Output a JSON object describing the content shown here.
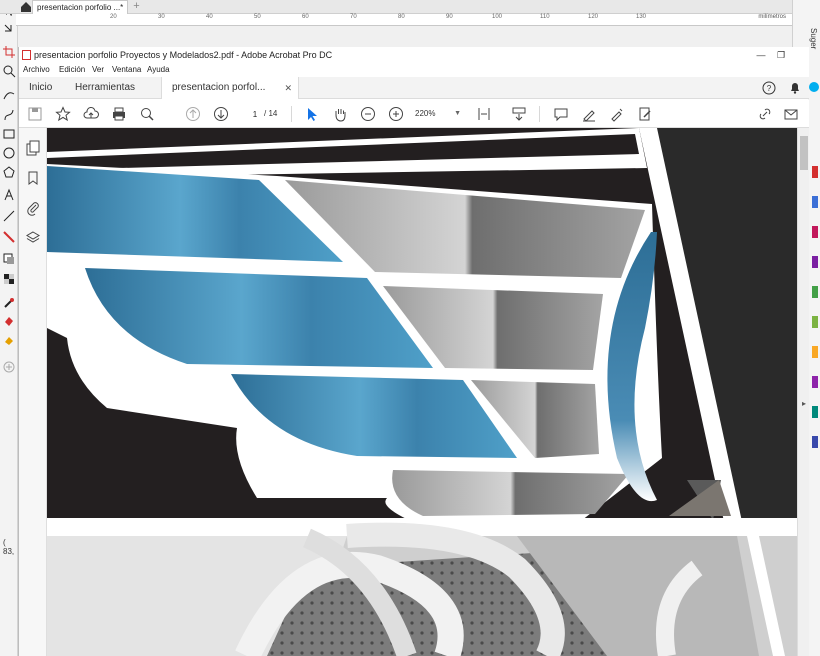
{
  "corel": {
    "doc_tab_title": "presentacion porfolio ...*",
    "ruler_units": "milímetros",
    "ruler_ticks": [
      "20",
      "30",
      "40",
      "50",
      "60",
      "70",
      "80",
      "90",
      "100",
      "110",
      "120",
      "130"
    ],
    "coords_readout": "( 83,",
    "side_panel_label": "Suger"
  },
  "acrobat": {
    "window_title": "presentacion porfolio Proyectos y Modelados2.pdf - Adobe Acrobat Pro DC",
    "menu": [
      "Archivo",
      "Edición",
      "Ver",
      "Ventana",
      "Ayuda"
    ],
    "tabs": {
      "home": "Inicio",
      "tools": "Herramientas",
      "document": "presentacion porfol..."
    },
    "toolbar": {
      "page_current": "1",
      "page_total": "/ 14",
      "zoom": "220%"
    }
  },
  "colors": {
    "wing_blue_dark": "#2d6e96",
    "wing_blue_light": "#4fa0c9",
    "background_dark": "#231f20",
    "accent_red": "#d32f2f"
  }
}
